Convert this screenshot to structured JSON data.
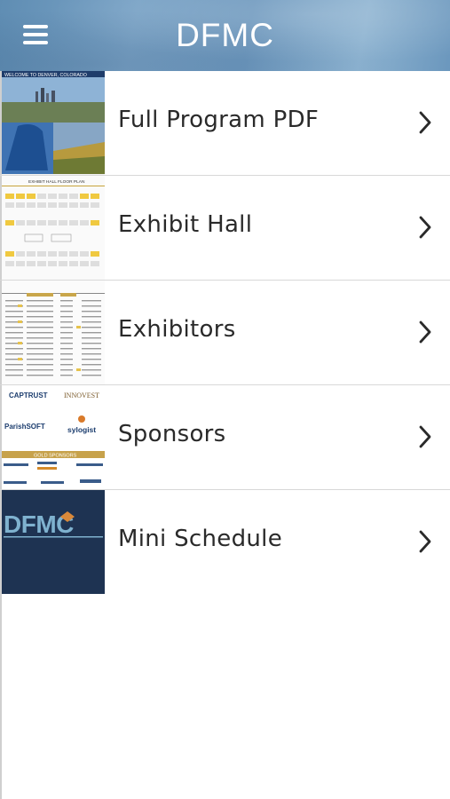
{
  "header": {
    "title": "DFMC",
    "menu_icon": "hamburger-menu-icon"
  },
  "items": [
    {
      "label": "Full Program PDF",
      "thumb_caption": "WELCOME TO DENVER, COLORADO"
    },
    {
      "label": "Exhibit Hall",
      "thumb_caption": "EXHIBIT HALL FLOOR PLAN"
    },
    {
      "label": "Exhibitors"
    },
    {
      "label": "Sponsors",
      "thumb_texts": [
        "CAPTRUST",
        "INNOVEST",
        "ParishSOFT",
        "sylogist",
        "GOLD SPONSORS"
      ]
    },
    {
      "label": "Mini Schedule",
      "thumb_caption": "DFMC"
    }
  ],
  "colors": {
    "header_blue": "#6c97bd",
    "text": "#2a2a2a",
    "divider": "#d8d8d8"
  },
  "chevron_icon": "chevron-right-icon"
}
